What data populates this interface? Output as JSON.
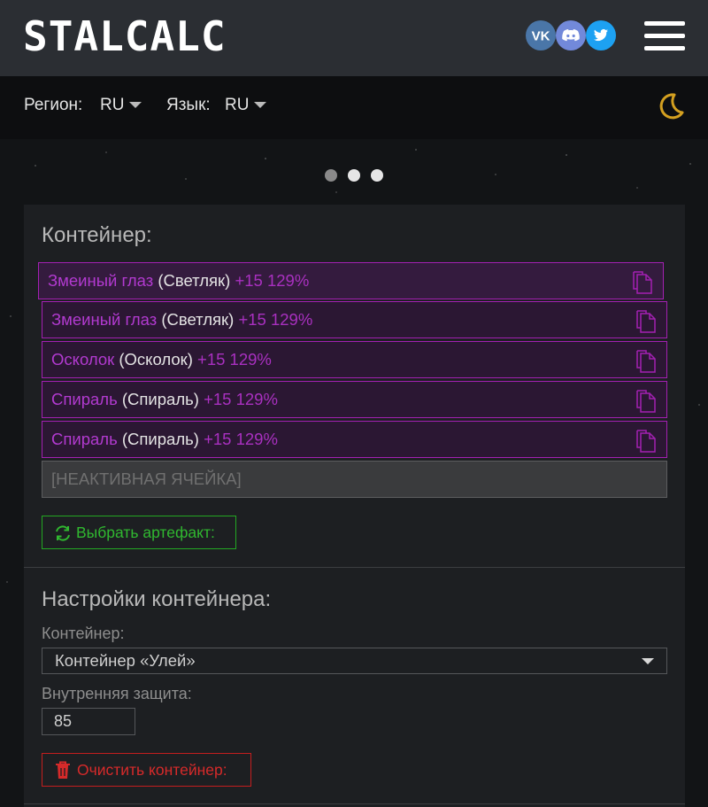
{
  "header": {
    "logo": "STALCALC",
    "social": [
      {
        "name": "vk",
        "color": "#4a76a8",
        "label": "VK"
      },
      {
        "name": "discord",
        "color": "#7289da"
      },
      {
        "name": "twitter",
        "color": "#1da1f2"
      }
    ],
    "menu_icon": "hamburger-icon"
  },
  "settings_bar": {
    "region_label": "Регион:",
    "region_value": "RU",
    "language_label": "Язык:",
    "language_value": "RU",
    "theme_icon": "moon-icon",
    "theme_color": "#d4a020"
  },
  "carousel": {
    "dots": 3,
    "active_index": 0
  },
  "container": {
    "title": "Контейнер:",
    "slots": [
      {
        "name": "Змеиный глаз",
        "base": "(Светляк)",
        "bonus": "+15 129%"
      },
      {
        "name": "Змеиный глаз",
        "base": "(Светляк)",
        "bonus": "+15 129%"
      },
      {
        "name": "Осколок",
        "base": "(Осколок)",
        "bonus": "+15 129%"
      },
      {
        "name": "Спираль",
        "base": "(Спираль)",
        "bonus": "+15 129%"
      },
      {
        "name": "Спираль",
        "base": "(Спираль)",
        "bonus": "+15 129%"
      }
    ],
    "inactive_slot": "[НЕАКТИВНАЯ ЯЧЕЙКА]",
    "select_artifact_button": "Выбрать артефакт:",
    "artifact_color": "#b23ad0"
  },
  "container_settings": {
    "title": "Настройки контейнера:",
    "container_label": "Контейнер:",
    "container_value": "Контейнер «Улей»",
    "inner_protection_label": "Внутренняя защита:",
    "inner_protection_value": "85",
    "clear_button": "Очистить контейнер:"
  }
}
